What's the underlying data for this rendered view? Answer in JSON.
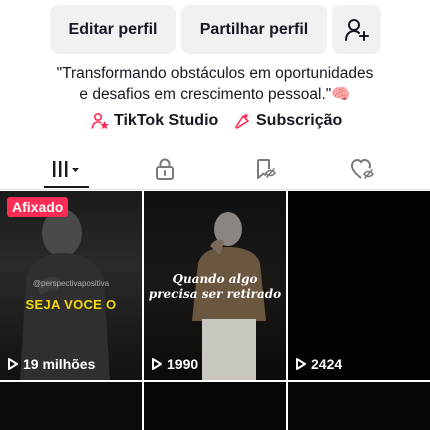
{
  "profile_actions": {
    "edit_label": "Editar perfil",
    "share_label": "Partilhar perfil",
    "add_friend_icon": "add-user-icon"
  },
  "bio": {
    "line1": "\"Transformando obstáculos em oportunidades",
    "line2": "e desafios em crescimento pessoal.\"",
    "emoji": "🧠"
  },
  "links": {
    "studio_label": "TikTok Studio",
    "subscription_label": "Subscrição",
    "studio_icon": "person-star-icon",
    "subscription_icon": "sparkle-badge-icon"
  },
  "tabs": [
    {
      "name": "videos",
      "icon": "grid-bars-icon",
      "active": true
    },
    {
      "name": "private",
      "icon": "lock-icon",
      "active": false
    },
    {
      "name": "reposts",
      "icon": "repost-hidden-icon",
      "active": false
    },
    {
      "name": "liked",
      "icon": "heart-hidden-icon",
      "active": false
    }
  ],
  "videos": [
    {
      "pinned_label": "Afixado",
      "views": "19 milhões",
      "overlay_text": "SEJA VOCE O",
      "watermark": "@perspectivapositiva"
    },
    {
      "views": "1990",
      "overlay_text_line1": "Quando algo",
      "overlay_text_line2": "precisa ser retirado"
    },
    {
      "views": "2424"
    }
  ],
  "colors": {
    "accent": "#fe2c55",
    "button_bg": "#f1f1f2",
    "text": "#161823",
    "caption_yellow": "#f5d90a"
  }
}
